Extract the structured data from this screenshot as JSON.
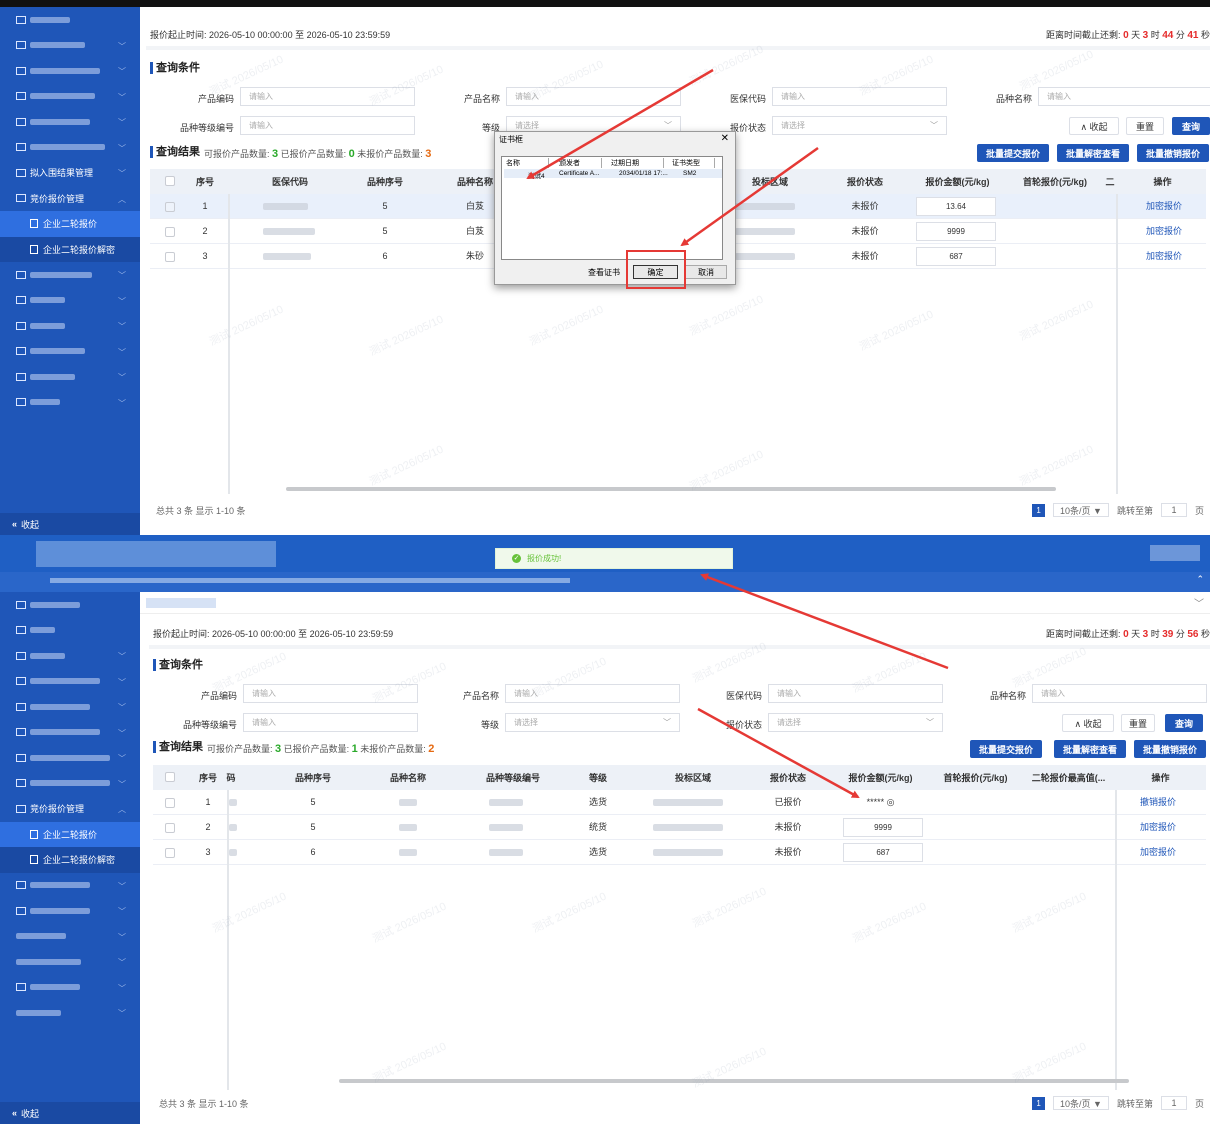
{
  "sidebar_top": {
    "items": [
      "拟入围结果管理",
      "竞价报价管理",
      "企业二轮报价",
      "企业二轮报价解密"
    ],
    "collapse": "收起"
  },
  "sidebar_bottom": {
    "items": [
      "竞价报价管理",
      "企业二轮报价",
      "企业二轮报价解密"
    ],
    "collapse": "收起"
  },
  "panel_top": {
    "period": "报价起止时间: 2026-05-10 00:00:00 至 2026-05-10 23:59:59",
    "countdown": {
      "prefix": "距离时间截止还剩: ",
      "days": "0",
      "d": " 天 ",
      "hours": "3",
      "h": " 时 ",
      "minutes": "44",
      "m": " 分 ",
      "seconds": "41",
      "s": " 秒"
    },
    "query_title": "查询条件",
    "result_title": "查询结果",
    "result_counts": {
      "quotable_label": "可报价产品数量: ",
      "quotable": "3",
      "quoted_label": " 已报价产品数量: ",
      "quoted": "0",
      "unquoted_label": " 未报价产品数量: ",
      "unquoted": "3"
    },
    "rows": [
      {
        "no": "1",
        "seq": "5",
        "name": "白芨",
        "status": "未报价",
        "price": "13.64",
        "op": "加密报价"
      },
      {
        "no": "2",
        "seq": "5",
        "name": "白芨",
        "status": "未报价",
        "price": "9999",
        "op": "加密报价"
      },
      {
        "no": "3",
        "seq": "6",
        "name": "朱砂",
        "status": "未报价",
        "price": "687",
        "op": "加密报价"
      }
    ],
    "total": "总共 3 条 显示 1-10 条"
  },
  "panel_bottom": {
    "period": "报价起止时间: 2026-05-10 00:00:00 至 2026-05-10 23:59:59",
    "countdown": {
      "prefix": "距离时间截止还剩: ",
      "days": "0",
      "d": " 天 ",
      "hours": "3",
      "h": " 时 ",
      "minutes": "39",
      "m": " 分 ",
      "seconds": "56",
      "s": " 秒"
    },
    "query_title": "查询条件",
    "result_title": "查询结果",
    "result_counts": {
      "quotable_label": "可报价产品数量: ",
      "quotable": "3",
      "quoted_label": " 已报价产品数量: ",
      "quoted": "1",
      "unquoted_label": " 未报价产品数量: ",
      "unquoted": "2"
    },
    "rows": [
      {
        "no": "1",
        "seq": "5",
        "grade": "选货",
        "status": "已报价",
        "price": "***** ◎",
        "op": "撤销报价"
      },
      {
        "no": "2",
        "seq": "5",
        "grade": "统货",
        "status": "未报价",
        "price": "9999",
        "op": "加密报价"
      },
      {
        "no": "3",
        "seq": "6",
        "grade": "选货",
        "status": "未报价",
        "price": "687",
        "op": "加密报价"
      }
    ],
    "total": "总共 3 条 显示 1-10 条"
  },
  "form": {
    "product_code": "产品编码",
    "product_name": "产品名称",
    "insurance_code": "医保代码",
    "variety_name": "品种名称",
    "variety_grade_code": "品种等级编号",
    "grade": "等级",
    "quote_status": "报价状态",
    "input_placeholder": "请输入",
    "select_placeholder": "请选择"
  },
  "buttons": {
    "collapse": "∧ 收起",
    "reset": "重置",
    "query": "查询",
    "batch_submit": "批量提交报价",
    "batch_decrypt": "批量解密查看",
    "batch_revoke": "批量撤销报价"
  },
  "columns_top": [
    "序号",
    "医保代码",
    "品种序号",
    "品种名称",
    "投标区域",
    "报价状态",
    "报价金额(元/kg)",
    "首轮报价(元/kg)",
    "二",
    "操作"
  ],
  "columns_bottom": [
    "序号",
    "码",
    "品种序号",
    "品种名称",
    "品种等级编号",
    "等级",
    "投标区域",
    "报价状态",
    "报价金额(元/kg)",
    "首轮报价(元/kg)",
    "二轮报价最高值(...",
    "操作"
  ],
  "pager": {
    "page": "1",
    "size": "10条/页 ▼",
    "jump_label": "跳转至第",
    "jump_value": "1",
    "page_unit": "页"
  },
  "dialog": {
    "title": "证书框",
    "columns": [
      "名称",
      "颁发者",
      "过期日期",
      "证书类型"
    ],
    "row": {
      "name": "测试4",
      "issuer": "Certificate A...",
      "expiry": "2034/01/18 17:...",
      "type": "SM2"
    },
    "view_cert": "查看证书",
    "ok": "确定",
    "cancel": "取消"
  },
  "toast": "报价成功!",
  "watermark": "测试 2026/05/10"
}
